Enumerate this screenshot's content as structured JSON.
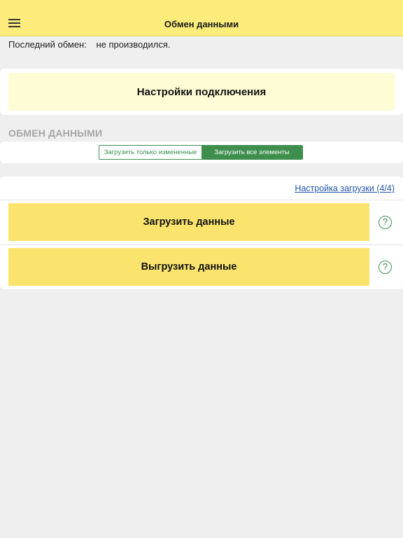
{
  "header": {
    "title": "Обмен данными",
    "menu_icon": "hamburger-menu-icon"
  },
  "status": {
    "last_exchange_label": "Последний обмен:",
    "last_exchange_value": "не производился."
  },
  "connection": {
    "settings_label": "Настройки подключения"
  },
  "exchange": {
    "section_title": "ОБМЕН ДАННЫМИ",
    "mode_options": [
      "Загрузить только измененные",
      "Загрузить все элементы"
    ],
    "selected_mode": "Загрузить все элементы",
    "load_settings_link": "Настройка загрузки (4/4)",
    "download_label": "Загрузить данные",
    "upload_label": "Выгрузить данные",
    "help_symbol": "?"
  },
  "colors": {
    "header_bg": "#fbec7c",
    "action_button_bg": "#fbe46e",
    "connection_button_bg": "#fdfcd4",
    "accent_green": "#3e8e4d",
    "link_blue": "#2458a8",
    "page_bg": "#efeff0"
  }
}
